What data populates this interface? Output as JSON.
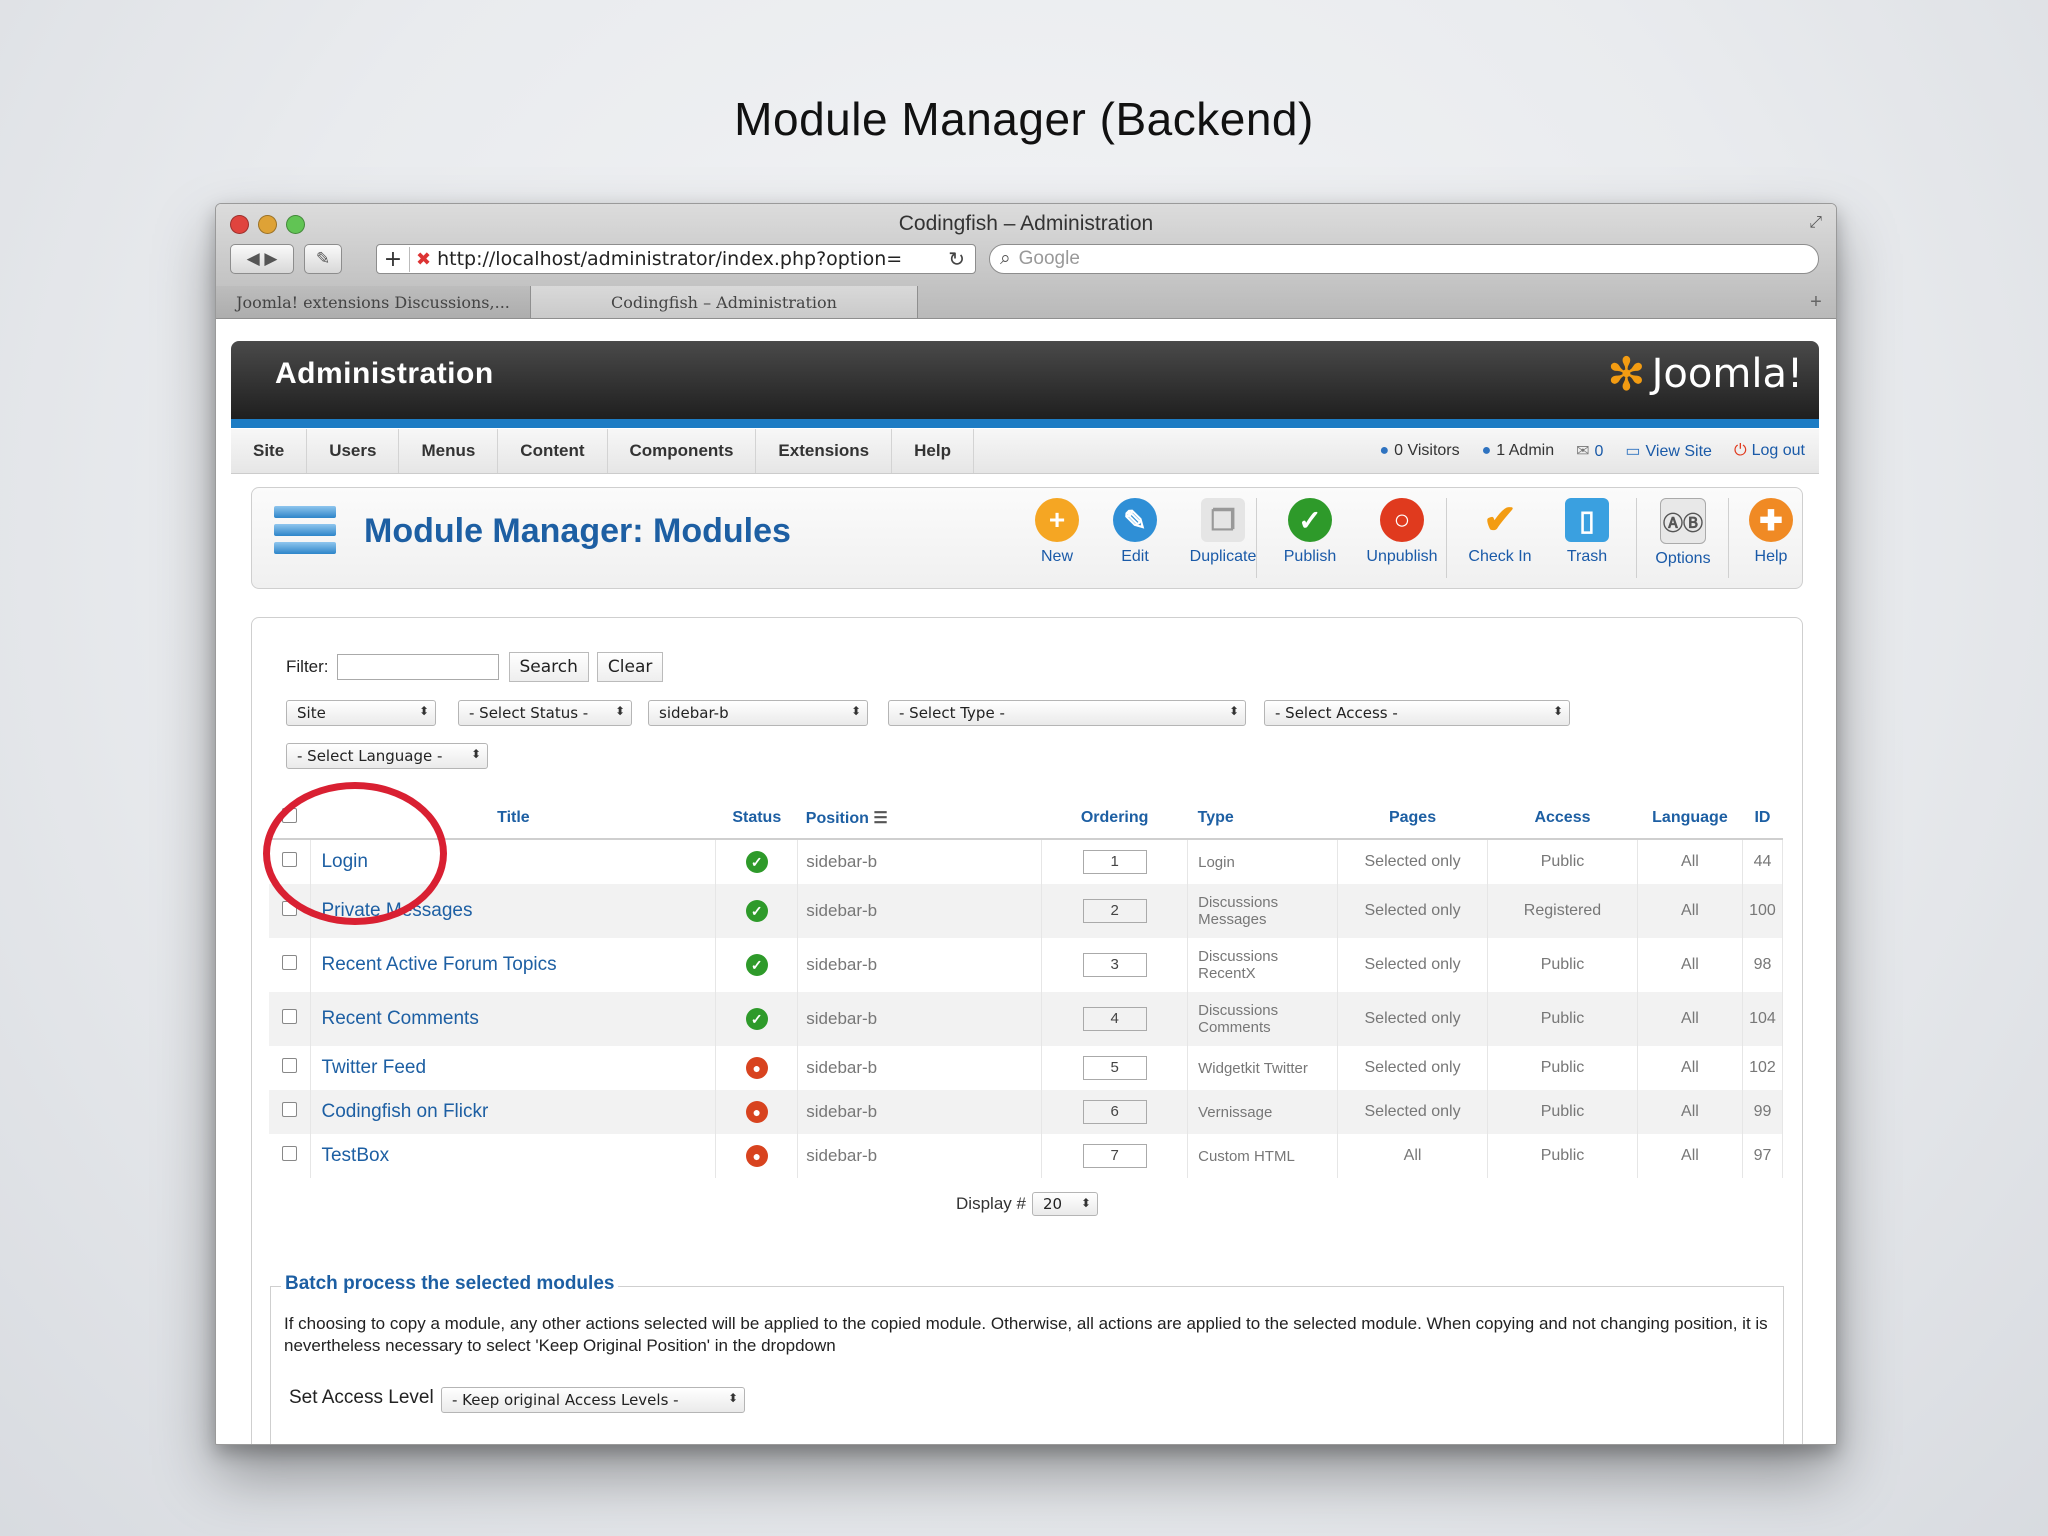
{
  "slide": {
    "title": "Module Manager (Backend)"
  },
  "window": {
    "title": "Codingfish – Administration",
    "url": "http://localhost/administrator/index.php?option=",
    "search_placeholder": "Google",
    "tabs": [
      "Joomla! extensions Discussions,...",
      "Codingfish – Administration"
    ]
  },
  "admin": {
    "header_title": "Administration",
    "logo_text": "Joomla!",
    "menu": [
      "Site",
      "Users",
      "Menus",
      "Content",
      "Components",
      "Extensions",
      "Help"
    ],
    "status": {
      "visitors": "0 Visitors",
      "admin": "1 Admin",
      "messages": "0",
      "view_site": "View Site",
      "logout": "Log out"
    }
  },
  "toolbar": {
    "title": "Module Manager: Modules",
    "buttons": {
      "new": "New",
      "edit": "Edit",
      "duplicate": "Duplicate",
      "publish": "Publish",
      "unpublish": "Unpublish",
      "checkin": "Check In",
      "trash": "Trash",
      "options": "Options",
      "help": "Help"
    }
  },
  "filters": {
    "filter_label": "Filter:",
    "search_label": "Search",
    "clear_label": "Clear",
    "site": "Site",
    "status": "- Select Status -",
    "position": "sidebar-b",
    "type": "- Select Type -",
    "access": "- Select Access -",
    "language": "- Select Language -"
  },
  "table": {
    "headers": {
      "title": "Title",
      "status": "Status",
      "position": "Position",
      "ordering": "Ordering",
      "type": "Type",
      "pages": "Pages",
      "access": "Access",
      "language": "Language",
      "id": "ID"
    },
    "rows": [
      {
        "title": "Login",
        "status": "published",
        "position": "sidebar-b",
        "ordering": "1",
        "type": "Login",
        "pages": "Selected only",
        "access": "Public",
        "language": "All",
        "id": "44"
      },
      {
        "title": "Private Messages",
        "status": "published",
        "position": "sidebar-b",
        "ordering": "2",
        "type": "Discussions Messages",
        "pages": "Selected only",
        "access": "Registered",
        "language": "All",
        "id": "100"
      },
      {
        "title": "Recent Active Forum Topics",
        "status": "published",
        "position": "sidebar-b",
        "ordering": "3",
        "type": "Discussions RecentX",
        "pages": "Selected only",
        "access": "Public",
        "language": "All",
        "id": "98"
      },
      {
        "title": "Recent Comments",
        "status": "published",
        "position": "sidebar-b",
        "ordering": "4",
        "type": "Discussions Comments",
        "pages": "Selected only",
        "access": "Public",
        "language": "All",
        "id": "104"
      },
      {
        "title": "Twitter Feed",
        "status": "unpublished",
        "position": "sidebar-b",
        "ordering": "5",
        "type": "Widgetkit Twitter",
        "pages": "Selected only",
        "access": "Public",
        "language": "All",
        "id": "102"
      },
      {
        "title": "Codingfish on Flickr",
        "status": "unpublished",
        "position": "sidebar-b",
        "ordering": "6",
        "type": "Vernissage",
        "pages": "Selected only",
        "access": "Public",
        "language": "All",
        "id": "99"
      },
      {
        "title": "TestBox",
        "status": "unpublished",
        "position": "sidebar-b",
        "ordering": "7",
        "type": "Custom HTML",
        "pages": "All",
        "access": "Public",
        "language": "All",
        "id": "97"
      }
    ]
  },
  "display": {
    "label": "Display #",
    "value": "20"
  },
  "batch": {
    "legend": "Batch process the selected modules",
    "text": "If choosing to copy a module, any other actions selected will be applied to the copied module. Otherwise, all actions are applied to the selected module. When copying and not changing position, it is nevertheless necessary to select 'Keep Original Position' in the dropdown",
    "access_label": "Set Access Level",
    "access_value": "- Keep original Access Levels -"
  },
  "colors": {
    "accent_blue": "#1d5fa3",
    "published": "#2e9a2a",
    "unpublished": "#d8431f",
    "annotation_red": "#d92032"
  }
}
